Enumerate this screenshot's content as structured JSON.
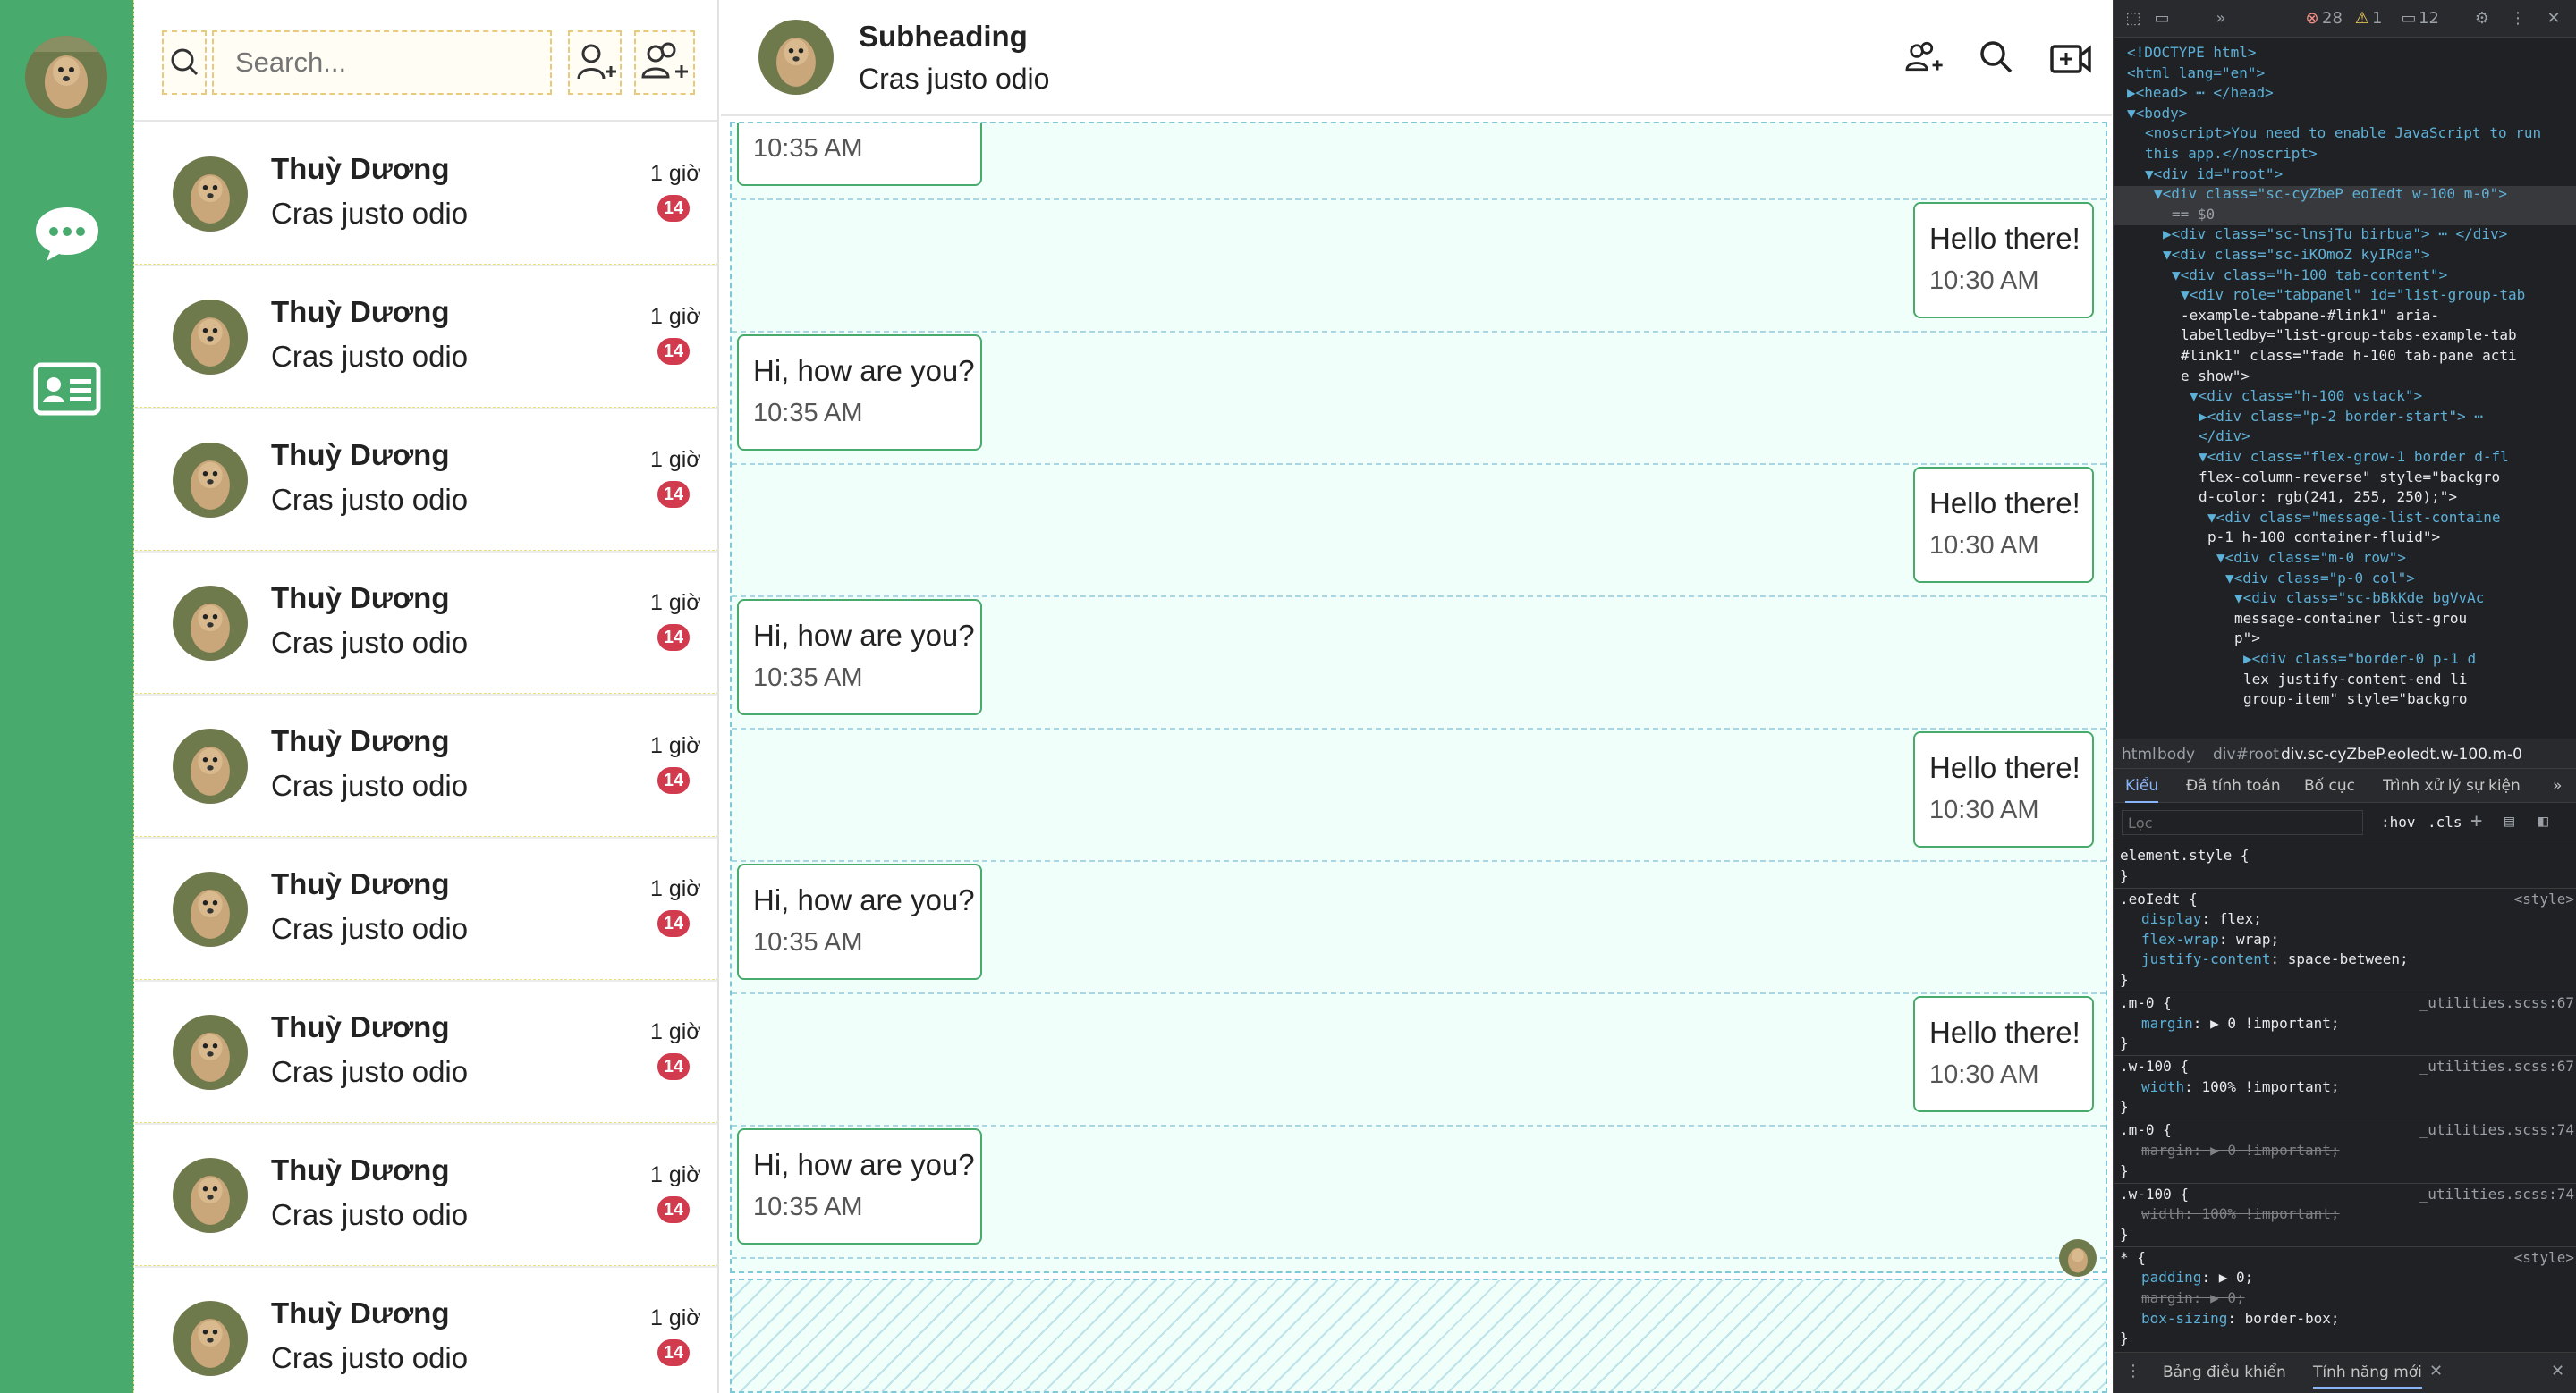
{
  "search": {
    "placeholder": "Search..."
  },
  "contacts": [
    {
      "name": "Thuỳ Dương",
      "message": "Cras justo odio",
      "time": "1 giờ",
      "unread": "14"
    },
    {
      "name": "Thuỳ Dương",
      "message": "Cras justo odio",
      "time": "1 giờ",
      "unread": "14"
    },
    {
      "name": "Thuỳ Dương",
      "message": "Cras justo odio",
      "time": "1 giờ",
      "unread": "14"
    },
    {
      "name": "Thuỳ Dương",
      "message": "Cras justo odio",
      "time": "1 giờ",
      "unread": "14"
    },
    {
      "name": "Thuỳ Dương",
      "message": "Cras justo odio",
      "time": "1 giờ",
      "unread": "14"
    },
    {
      "name": "Thuỳ Dương",
      "message": "Cras justo odio",
      "time": "1 giờ",
      "unread": "14"
    },
    {
      "name": "Thuỳ Dương",
      "message": "Cras justo odio",
      "time": "1 giờ",
      "unread": "14"
    },
    {
      "name": "Thuỳ Dương",
      "message": "Cras justo odio",
      "time": "1 giờ",
      "unread": "14"
    },
    {
      "name": "Thuỳ Dương",
      "message": "Cras justo odio",
      "time": "1 giờ",
      "unread": "14"
    }
  ],
  "chat": {
    "title": "Subheading",
    "subtitle": "Cras justo odio",
    "messages": [
      {
        "side": "received",
        "text": "",
        "time": "10:35 AM"
      },
      {
        "side": "sent",
        "text": "Hello there!",
        "time": "10:30 AM"
      },
      {
        "side": "received",
        "text": "Hi, how are you?",
        "time": "10:35 AM"
      },
      {
        "side": "sent",
        "text": "Hello there!",
        "time": "10:30 AM"
      },
      {
        "side": "received",
        "text": "Hi, how are you?",
        "time": "10:35 AM"
      },
      {
        "side": "sent",
        "text": "Hello there!",
        "time": "10:30 AM"
      },
      {
        "side": "received",
        "text": "Hi, how are you?",
        "time": "10:35 AM"
      },
      {
        "side": "sent",
        "text": "Hello there!",
        "time": "10:30 AM"
      },
      {
        "side": "received",
        "text": "Hi, how are you?",
        "time": "10:35 AM"
      }
    ]
  },
  "colors": {
    "rail": "#48aa6d",
    "badge": "#d23a4d",
    "bubble_border": "#48aa6d",
    "chat_bg": "#f1fffa"
  },
  "devtools": {
    "errors": "28",
    "warnings": "1",
    "messages": "12",
    "dom": [
      "<!DOCTYPE html>",
      "<html lang=\"en\">",
      "▶<head> ⋯ </head>",
      "▼<body>",
      "<noscript>You need to enable JavaScript to run",
      "this app.</noscript>",
      "▼<div id=\"root\">",
      "▼<div class=\"sc-cyZbeP eoIedt w-100 m-0\">",
      "== $0",
      "▶<div class=\"sc-lnsjTu birbua\"> ⋯ </div>",
      "▼<div class=\"sc-iKOmoZ kyIRda\">",
      "▼<div class=\"h-100 tab-content\">",
      "▼<div role=\"tabpanel\" id=\"list-group-tab",
      "-example-tabpane-#link1\" aria-",
      "labelledby=\"list-group-tabs-example-tab",
      "#link1\" class=\"fade h-100 tab-pane acti",
      "e show\">",
      "▼<div class=\"h-100 vstack\">",
      "▶<div class=\"p-2 border-start\"> ⋯",
      "</div>",
      "▼<div class=\"flex-grow-1 border d-fl",
      "flex-column-reverse\" style=\"backgro",
      "d-color: rgb(241, 255, 250);\">",
      "▼<div class=\"message-list-containe",
      "p-1 h-100 container-fluid\">",
      "▼<div class=\"m-0 row\">",
      "▼<div class=\"p-0 col\">",
      "▼<div class=\"sc-bBkKde bgVvAc",
      "message-container list-grou",
      "p\">",
      "▶<div class=\"border-0 p-1 d",
      "lex justify-content-end li",
      "group-item\" style=\"backgro"
    ],
    "breadcrumbs": [
      "html",
      "body",
      "div#root",
      "div.sc-cyZbeP.eoIedt.w-100.m-0"
    ],
    "tabs": [
      "Kiểu",
      "Đã tính toán",
      "Bố cục",
      "Trình xử lý sự kiện"
    ],
    "filter_placeholder": "Lọc",
    "hov": ":hov",
    "cls": ".cls",
    "styles": [
      {
        "selector": "element.style {",
        "source": ""
      },
      {
        "selector": "}",
        "source": ""
      },
      {
        "selector": ".eoIedt {",
        "source": "<style>"
      },
      {
        "prop": "display",
        "value": "flex;"
      },
      {
        "prop": "flex-wrap",
        "value": "wrap;"
      },
      {
        "prop": "justify-content",
        "value": "space-between;"
      },
      {
        "selector": "}",
        "source": ""
      },
      {
        "selector": ".m-0 {",
        "source": "_utilities.scss:67"
      },
      {
        "prop": "margin",
        "value": "▶ 0 !important;"
      },
      {
        "selector": "}",
        "source": ""
      },
      {
        "selector": ".w-100 {",
        "source": "_utilities.scss:67"
      },
      {
        "prop": "width",
        "value": "100% !important;"
      },
      {
        "selector": "}",
        "source": ""
      },
      {
        "selector": ".m-0 {",
        "source": "_utilities.scss:74"
      },
      {
        "prop": "margin",
        "value": "▶ 0 !important;",
        "struck": true
      },
      {
        "selector": "}",
        "source": ""
      },
      {
        "selector": ".w-100 {",
        "source": "_utilities.scss:74"
      },
      {
        "prop": "width",
        "value": "100% !important;",
        "struck": true
      },
      {
        "selector": "}",
        "source": ""
      },
      {
        "selector": "* {",
        "source": "<style>"
      },
      {
        "prop": "padding",
        "value": "▶ 0;"
      },
      {
        "prop": "margin",
        "value": "▶ 0;",
        "struck": true
      },
      {
        "prop": "box-sizing",
        "value": "border-box;"
      },
      {
        "selector": "}",
        "source": ""
      }
    ],
    "drawer_tabs": [
      "Bảng điều khiển",
      "Tính năng mới"
    ]
  }
}
